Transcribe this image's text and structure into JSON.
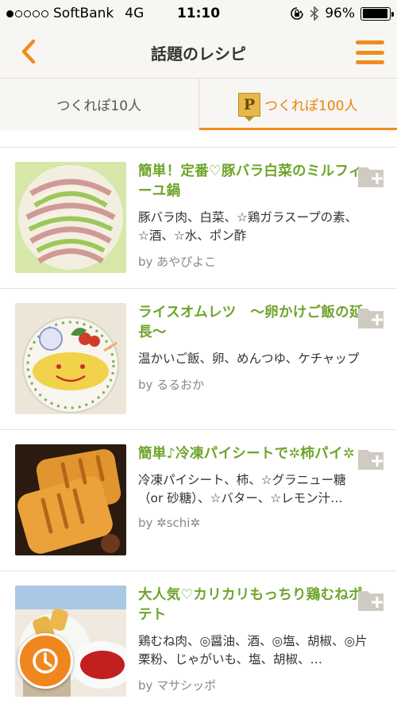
{
  "status_bar": {
    "carrier": "SoftBank",
    "network": "4G",
    "time": "11:10",
    "battery": "96%",
    "battery_level": 0.96,
    "signal_bars": 1,
    "signal_total": 5
  },
  "nav": {
    "title": "話題のレシピ",
    "back_icon": "chevron-left-icon",
    "menu_icon": "hamburger-menu-icon",
    "accent": "#f08c1e"
  },
  "tabs": [
    {
      "label": "つくれぽ10人",
      "active": false
    },
    {
      "label": "つくれぽ100人",
      "active": true,
      "badge": "P"
    }
  ],
  "recipes": [
    {
      "title": "簡単！定番♡豚バラ白菜のミルフィーユ鍋",
      "ingredients": "豚バラ肉、白菜、☆鶏ガラスープの素、☆酒、☆水、ポン酢",
      "author": "by あやぴよこ"
    },
    {
      "title": "ライスオムレツ　～卵かけご飯の延長～",
      "ingredients": "温かいご飯、卵、めんつゆ、ケチャップ",
      "author": "by るるおか"
    },
    {
      "title": "簡単♪冷凍パイシートで✲柿パイ✲",
      "ingredients": "冷凍パイシート、柿、☆グラニュー糖（or 砂糖）、☆バター、☆レモン汁…",
      "author": "by ✲schi✲"
    },
    {
      "title": "大人気♡カリカリもっちり鶏むねポテト",
      "ingredients": "鶏むね肉、◎醤油、酒、◎塩、胡椒、◎片栗粉、じゃがいも、塩、胡椒、…",
      "author": "by マサシッポ"
    }
  ],
  "colors": {
    "title_green": "#6ea42a",
    "accent_orange": "#f08c1e"
  }
}
